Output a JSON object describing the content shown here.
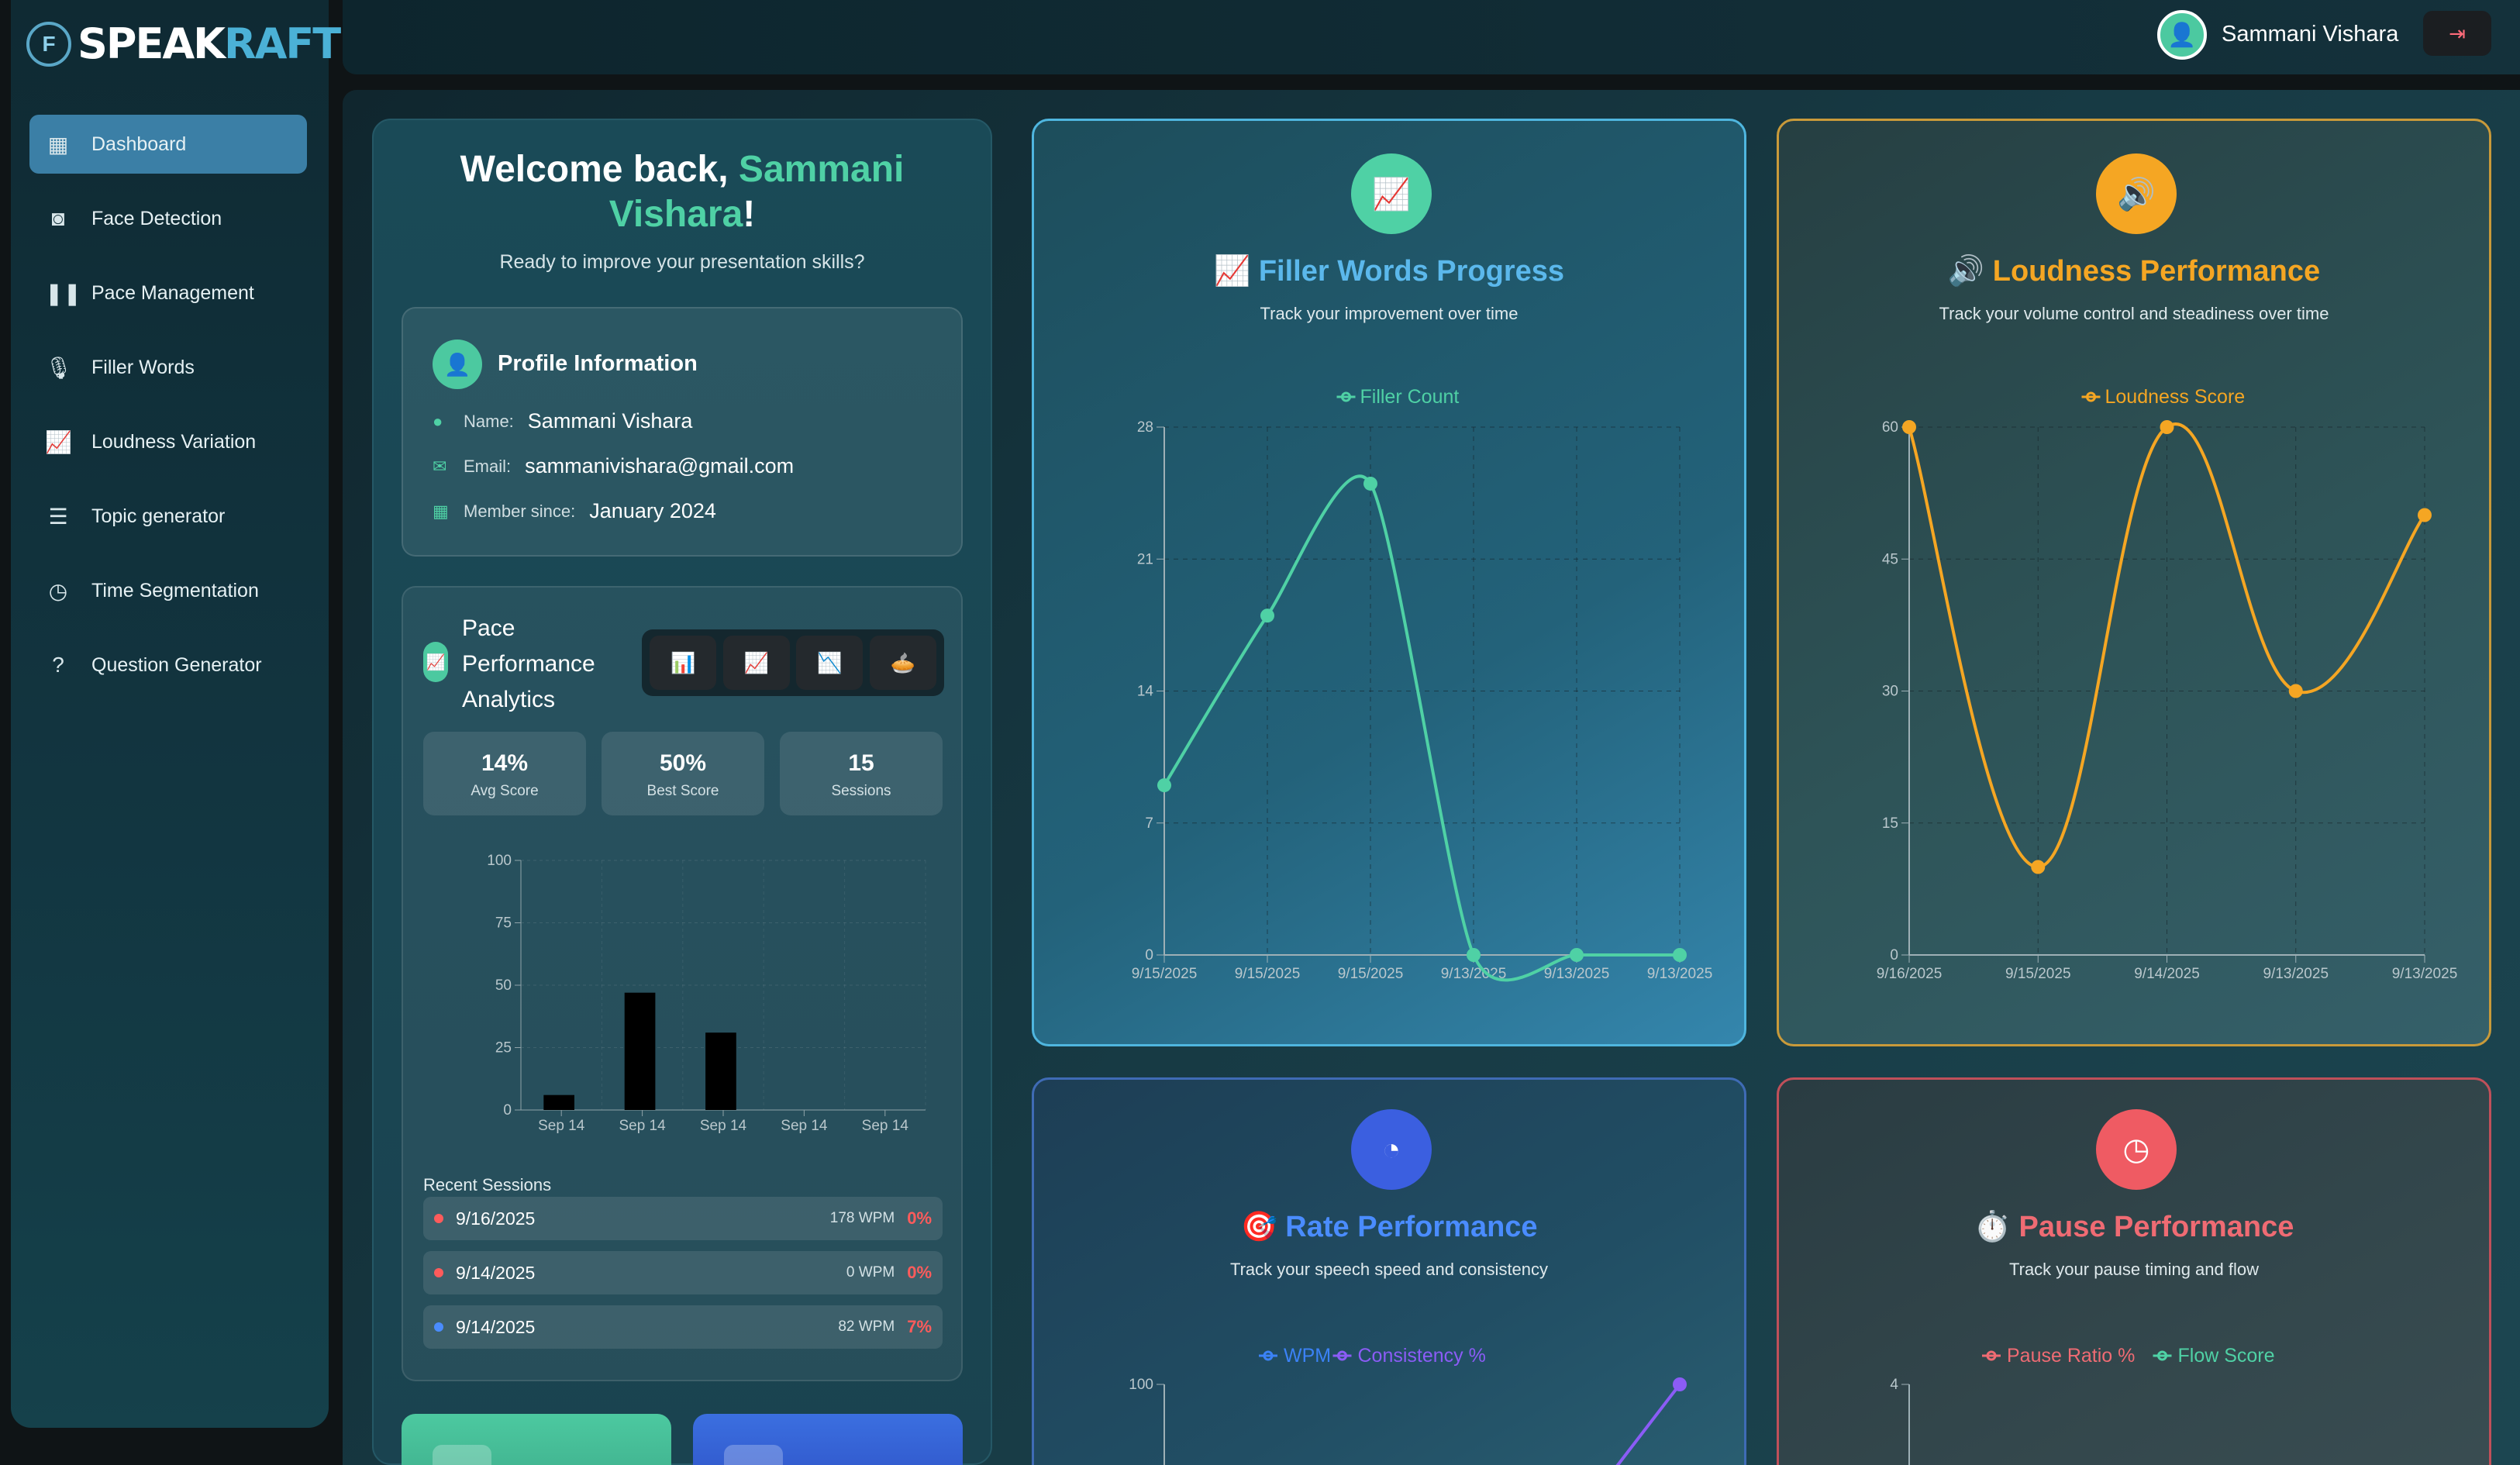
{
  "app": {
    "logo_a": "SPEAK",
    "logo_b": "RAFT",
    "logo_badge": "F"
  },
  "sidebar": {
    "items": [
      {
        "label": "Dashboard",
        "icon": "dashboard-icon",
        "glyph": "▦",
        "active": true
      },
      {
        "label": "Face Detection",
        "icon": "camera-icon",
        "glyph": "◙",
        "active": false
      },
      {
        "label": "Pace Management",
        "icon": "pause-bars-icon",
        "glyph": "❚❚",
        "active": false
      },
      {
        "label": "Filler Words",
        "icon": "microphone-icon",
        "glyph": "🎙",
        "active": false
      },
      {
        "label": "Loudness Variation",
        "icon": "line-chart-icon",
        "glyph": "📈",
        "active": false
      },
      {
        "label": "Topic generator",
        "icon": "list-icon",
        "glyph": "☰",
        "active": false
      },
      {
        "label": "Time Segmentation",
        "icon": "clock-icon",
        "glyph": "◷",
        "active": false
      },
      {
        "label": "Question Generator",
        "icon": "question-icon",
        "glyph": "?",
        "active": false
      }
    ]
  },
  "header": {
    "user_name": "Sammani Vishara",
    "logout_glyph": "⇥"
  },
  "welcome": {
    "prefix": "Welcome back, ",
    "name_line1": "Sammani",
    "name_line2": "Vishara",
    "suffix": "!",
    "subtitle": "Ready to improve your presentation skills?"
  },
  "profile": {
    "title": "Profile Information",
    "name_label": "Name:",
    "name_value": "Sammani Vishara",
    "email_label": "Email:",
    "email_value": "sammanivishara@gmail.com",
    "since_label": "Member since:",
    "since_value": "January 2024"
  },
  "pace": {
    "title": "Pace Performance Analytics",
    "chart_buttons": [
      "📊",
      "📈",
      "📉",
      "🥧"
    ],
    "stats": [
      {
        "value": "14%",
        "label": "Avg Score"
      },
      {
        "value": "50%",
        "label": "Best Score"
      },
      {
        "value": "15",
        "label": "Sessions"
      }
    ],
    "recent_title": "Recent Sessions",
    "sessions": [
      {
        "date": "9/16/2025",
        "wpm": "178 WPM",
        "pct": "0%",
        "dot": "#ff5b5b"
      },
      {
        "date": "9/14/2025",
        "wpm": "0 WPM",
        "pct": "0%",
        "dot": "#ff5b5b"
      },
      {
        "date": "9/14/2025",
        "wpm": "82 WPM",
        "pct": "7%",
        "dot": "#4a8cff"
      }
    ]
  },
  "cards": {
    "filler": {
      "title": "📈 Filler Words Progress",
      "subtitle": "Track your improvement over time"
    },
    "loudness": {
      "title": "🔊 Loudness Performance",
      "subtitle": "Track your volume control and steadiness over time"
    },
    "rate": {
      "title": "🎯 Rate Performance",
      "subtitle": "Track your speech speed and consistency"
    },
    "pause": {
      "title": "⏱️ Pause Performance",
      "subtitle": "Track your pause timing and flow"
    }
  },
  "chart_data": [
    {
      "id": "pace",
      "type": "bar",
      "categories": [
        "Sep 14",
        "Sep 14",
        "Sep 14",
        "Sep 14",
        "Sep 14"
      ],
      "values": [
        6,
        47,
        31,
        0,
        0
      ],
      "ylim": [
        0,
        100
      ],
      "yticks": [
        0,
        25,
        50,
        75,
        100
      ],
      "color": "#000000"
    },
    {
      "id": "filler",
      "type": "line",
      "series": [
        {
          "name": "Filler Count",
          "color": "#4fd1a5",
          "x": [
            "9/15/2025",
            "9/15/2025",
            "9/15/2025",
            "9/13/2025",
            "9/13/2025",
            "9/13/2025"
          ],
          "values": [
            9,
            18,
            25,
            0,
            0,
            0
          ]
        }
      ],
      "ylim": [
        0,
        28
      ],
      "yticks": [
        0,
        7,
        14,
        21,
        28
      ]
    },
    {
      "id": "loudness",
      "type": "line",
      "series": [
        {
          "name": "Loudness Score",
          "color": "#f5a623",
          "x": [
            "9/16/2025",
            "9/15/2025",
            "9/14/2025",
            "9/13/2025",
            "9/13/2025"
          ],
          "values": [
            60,
            10,
            60,
            30,
            50
          ]
        }
      ],
      "ylim": [
        0,
        60
      ],
      "yticks": [
        0,
        15,
        30,
        45,
        60
      ]
    },
    {
      "id": "rate",
      "type": "line",
      "legend": [
        "WPM",
        "Consistency %"
      ],
      "legend_colors": [
        "#3b82f6",
        "#8b5cf6"
      ],
      "ytop": "100"
    },
    {
      "id": "pause",
      "type": "line",
      "legend": [
        "Pause Ratio %",
        "Flow Score"
      ],
      "legend_colors": [
        "#ef6b73",
        "#4fd1a5"
      ],
      "ytop": "4"
    }
  ]
}
